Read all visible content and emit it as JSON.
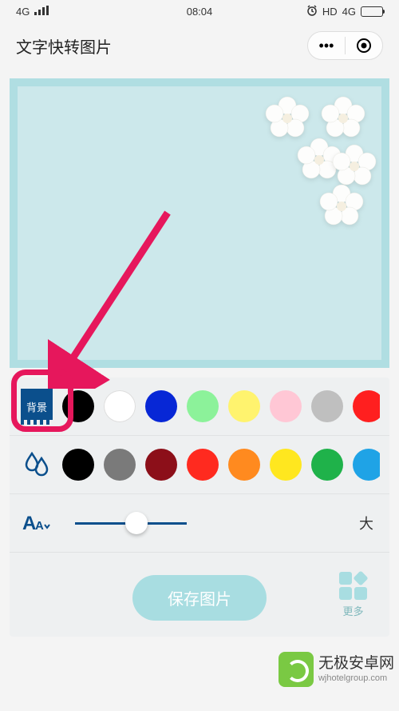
{
  "status": {
    "network_left": "4G",
    "time": "08:04",
    "hd": "HD",
    "network_right": "4G"
  },
  "nav": {
    "title": "文字快转图片",
    "menu_label": "•••"
  },
  "tools": {
    "bg_label": "背景",
    "bg_swatches": [
      "#000000",
      "#ffffff",
      "#0727d6",
      "#8cf29a",
      "#fff36e",
      "#ffc7d5",
      "#bfbfbf",
      "#ff1f1f"
    ],
    "color_swatches": [
      "#000000",
      "#7a7a7a",
      "#8c0f19",
      "#ff2a1f",
      "#ff8a1f",
      "#ffe71f",
      "#1fb24a",
      "#1fa3e6"
    ],
    "size_label": "大"
  },
  "actions": {
    "save_label": "保存图片",
    "more_label": "更多"
  },
  "watermark": {
    "main": "无极安卓网",
    "sub": "wjhotelgroup.com"
  }
}
